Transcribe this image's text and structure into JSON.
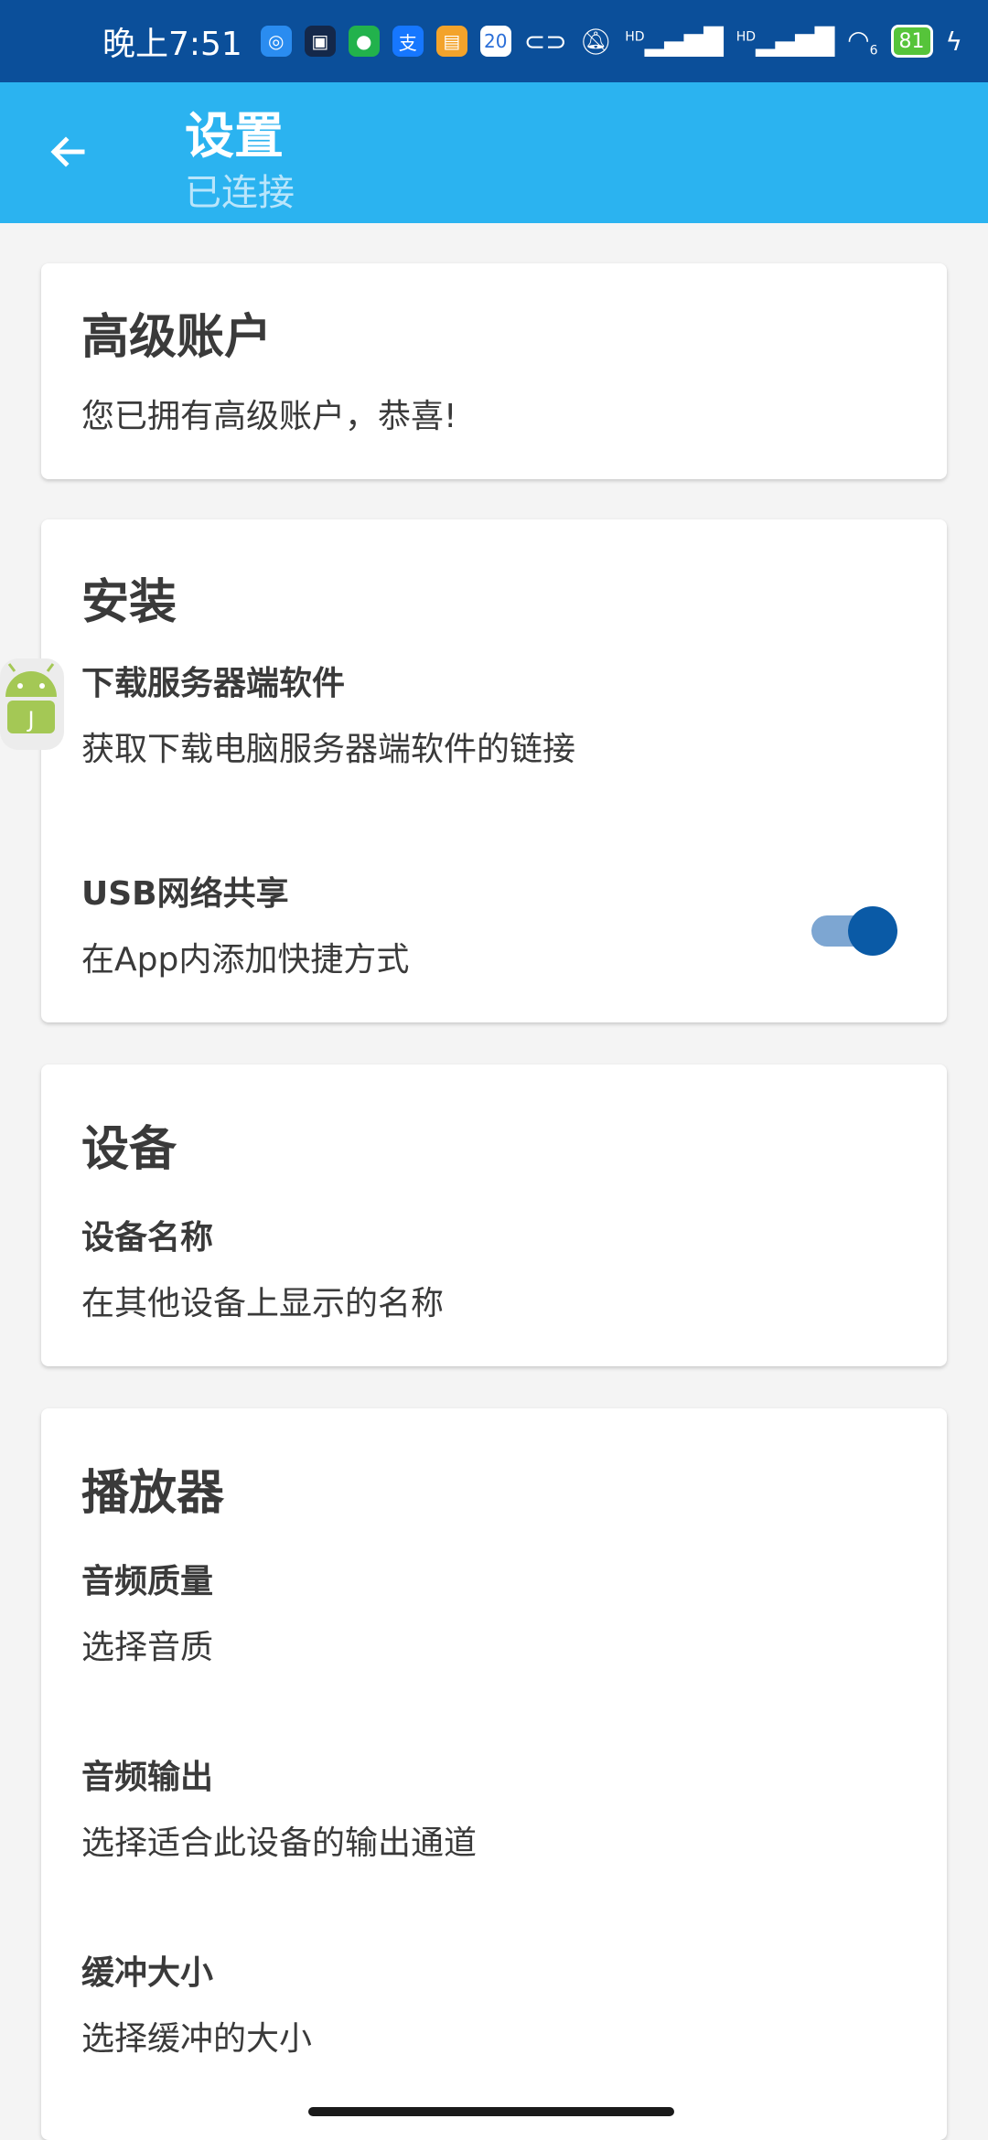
{
  "status_bar": {
    "time": "晚上7:51",
    "icons": [
      "qq-icon",
      "app-icon",
      "wechat-icon",
      "alipay-icon",
      "notes-icon",
      "calendar-icon",
      "link-icon",
      "mute-icon",
      "hd-signal-icon",
      "hd-signal-icon",
      "wifi-icon",
      "battery-icon",
      "charging-icon"
    ],
    "calendar_day": "20",
    "battery": "81",
    "signal_label": "HD",
    "wifi_label": "6"
  },
  "app_bar": {
    "title": "设置",
    "subtitle": "已连接",
    "color": "#2bb3f0"
  },
  "premium": {
    "title": "高级账户",
    "subtitle": "您已拥有高级账户，恭喜!"
  },
  "install": {
    "title": "安装",
    "items": [
      {
        "title": "下载服务器端软件",
        "subtitle": "获取下载电脑服务器端软件的链接"
      },
      {
        "title": "USB网络共享",
        "subtitle": "在App内添加快捷方式",
        "toggle_on": true
      }
    ]
  },
  "device": {
    "title": "设备",
    "items": [
      {
        "title": "设备名称",
        "subtitle": "在其他设备上显示的名称"
      }
    ]
  },
  "player": {
    "title": "播放器",
    "items": [
      {
        "title": "音频质量",
        "subtitle": "选择音质"
      },
      {
        "title": "音频输出",
        "subtitle": "选择适合此设备的输出通道"
      },
      {
        "title": "缓冲大小",
        "subtitle": "选择缓冲的大小"
      }
    ]
  }
}
